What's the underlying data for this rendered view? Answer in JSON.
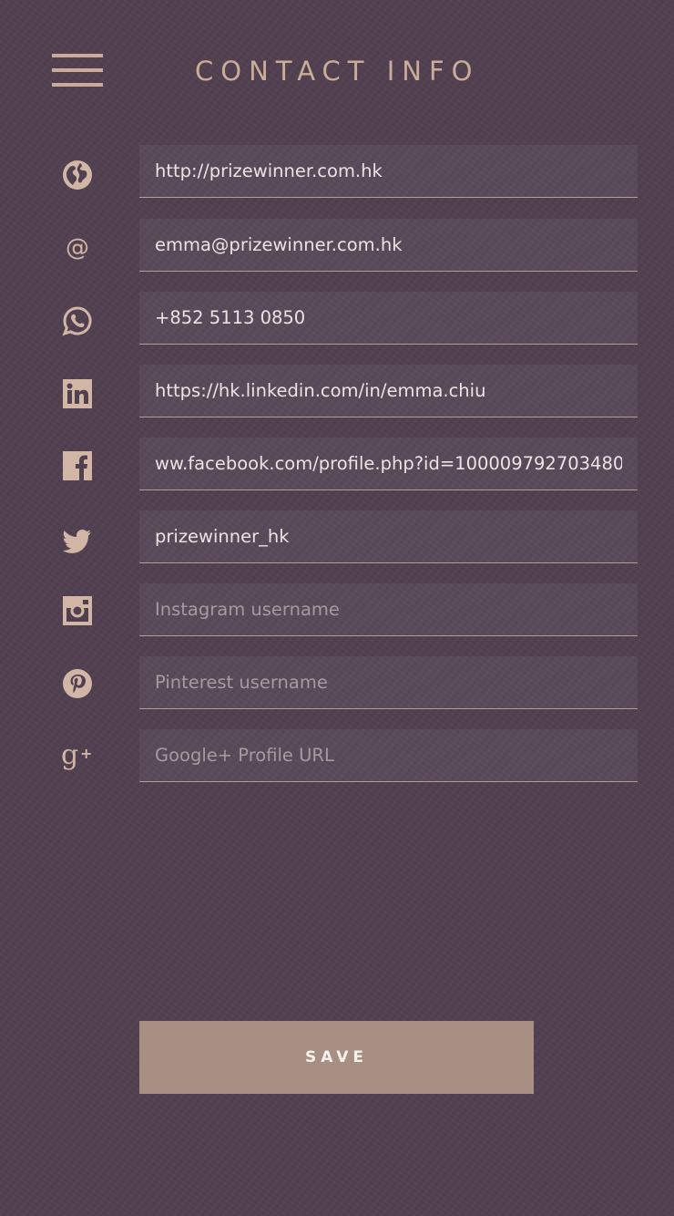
{
  "header": {
    "title": "CONTACT INFO",
    "menu_icon": "hamburger-menu-icon"
  },
  "fields": [
    {
      "id": "website",
      "icon": "globe-icon",
      "value": "http://prizewinner.com.hk",
      "placeholder": ""
    },
    {
      "id": "email",
      "icon": "at-sign-icon",
      "value": "emma@prizewinner.com.hk",
      "placeholder": ""
    },
    {
      "id": "whatsapp",
      "icon": "whatsapp-icon",
      "value": "+852 5113 0850",
      "placeholder": ""
    },
    {
      "id": "linkedin",
      "icon": "linkedin-icon",
      "value": "https://hk.linkedin.com/in/emma.chiu",
      "placeholder": ""
    },
    {
      "id": "facebook",
      "icon": "facebook-icon",
      "value": "ww.facebook.com/profile.php?id=100009792703480",
      "placeholder": ""
    },
    {
      "id": "twitter",
      "icon": "twitter-icon",
      "value": "prizewinner_hk",
      "placeholder": ""
    },
    {
      "id": "instagram",
      "icon": "instagram-icon",
      "value": "",
      "placeholder": "Instagram username"
    },
    {
      "id": "pinterest",
      "icon": "pinterest-icon",
      "value": "",
      "placeholder": "Pinterest username"
    },
    {
      "id": "googleplus",
      "icon": "google-plus-icon",
      "value": "",
      "placeholder": "Google+ Profile URL"
    }
  ],
  "save_label": "SAVE",
  "colors": {
    "background": "#504050",
    "accent": "#c9ab98",
    "button": "#a78f83",
    "field_underline": "#b89d8b"
  }
}
